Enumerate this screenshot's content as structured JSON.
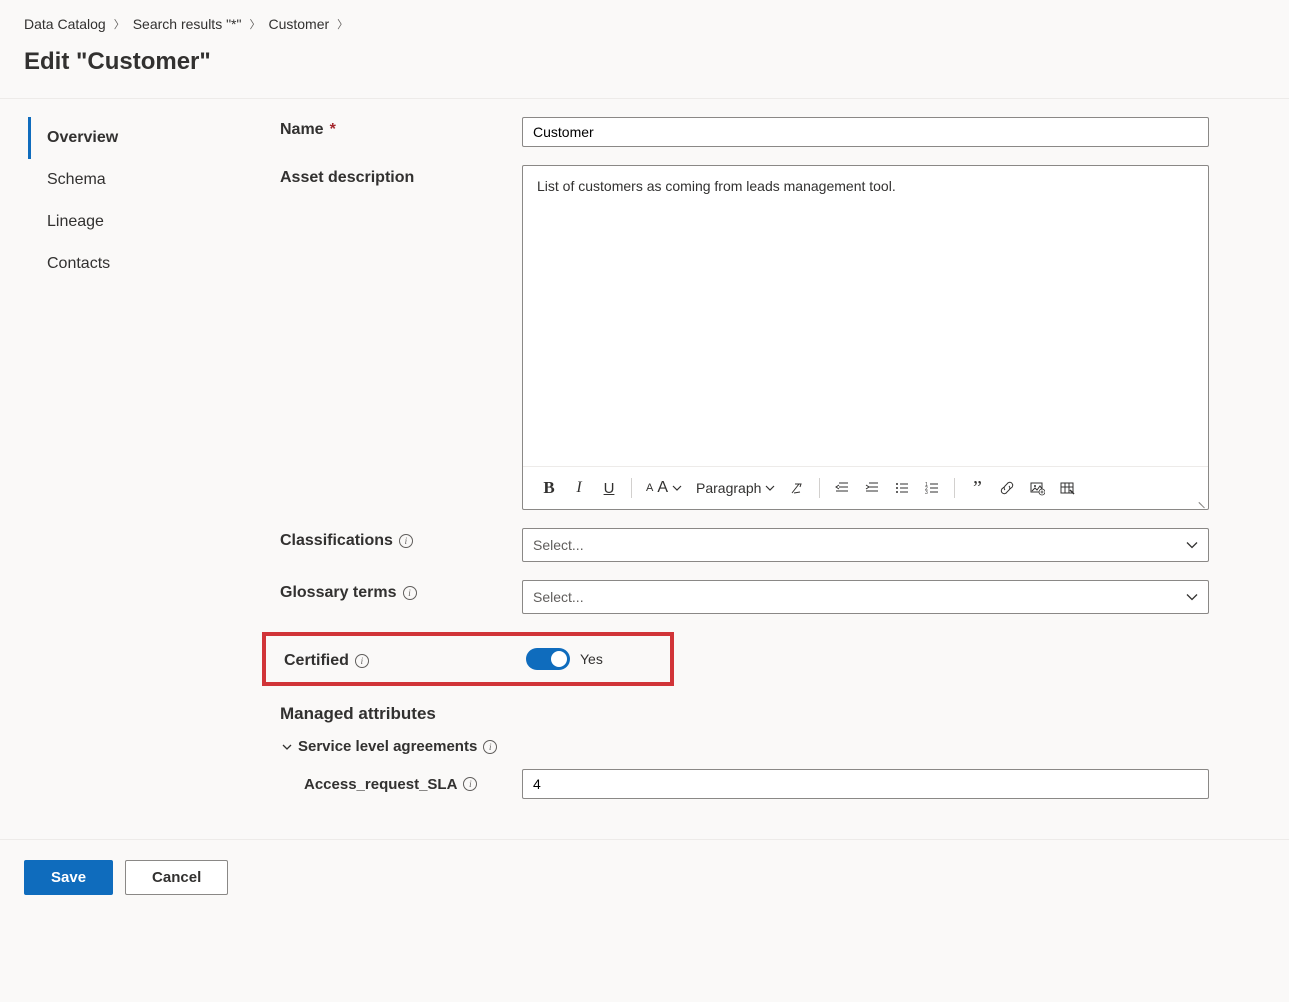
{
  "breadcrumb": [
    {
      "label": "Data Catalog"
    },
    {
      "label": "Search results \"*\""
    },
    {
      "label": "Customer"
    }
  ],
  "page_title": "Edit \"Customer\"",
  "sidebar": {
    "items": [
      {
        "label": "Overview",
        "active": true
      },
      {
        "label": "Schema"
      },
      {
        "label": "Lineage"
      },
      {
        "label": "Contacts"
      }
    ]
  },
  "form": {
    "name_label": "Name",
    "name_value": "Customer",
    "desc_label": "Asset description",
    "desc_value": "List of customers as coming from leads management tool.",
    "para_label": "Paragraph",
    "classifications_label": "Classifications",
    "classifications_placeholder": "Select...",
    "glossary_label": "Glossary terms",
    "glossary_placeholder": "Select...",
    "certified_label": "Certified",
    "certified_value_label": "Yes",
    "managed_attrs_heading": "Managed attributes",
    "sla_section": "Service level agreements",
    "sla_attr_label": "Access_request_SLA",
    "sla_attr_value": "4"
  },
  "footer": {
    "save_label": "Save",
    "cancel_label": "Cancel"
  }
}
